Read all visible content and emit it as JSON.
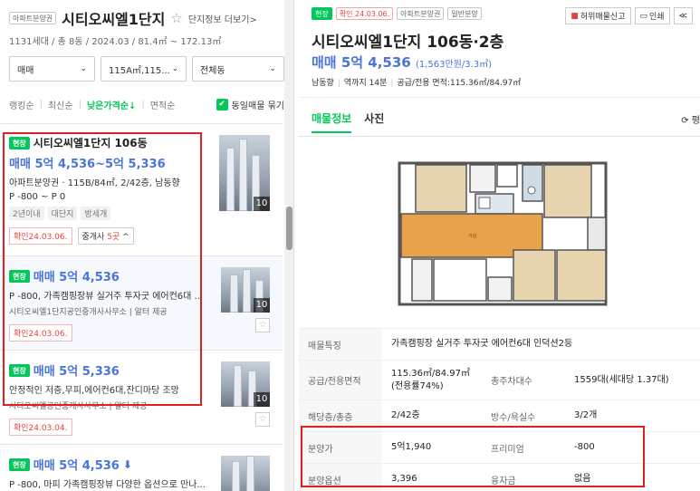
{
  "left": {
    "tag": "아파트분양권",
    "complex_name": "시티오씨엘1단지",
    "star": "☆",
    "more_link": "단지정보 더보기>",
    "meta": "1131세대 / 총 8동 / 2024.03 / 81.4㎡ ~ 172.13㎡",
    "filters": [
      {
        "label": "매매"
      },
      {
        "label": "115A㎡,115..."
      },
      {
        "label": "전체동"
      }
    ],
    "sort": {
      "ranking": "랭킹순",
      "newest": "최신순",
      "low_price": "낮은가격순↓",
      "area": "면적순",
      "same_group": "동일매물 묶기",
      "check": "✔"
    },
    "items": [
      {
        "badge": "현장",
        "title": "시티오씨엘1단지 106동",
        "price": "매매 5억 4,536~5억 5,336",
        "desc": "아파트분양권 · 115B/84㎡, 2/42층, 남동향",
        "sub": "P -800 ~ P 0",
        "chips": [
          "2년이내",
          "대단지",
          "방세개"
        ],
        "confirm": "확인24.03.06.",
        "brokers_prefix": "중개사 ",
        "brokers_count": "5곳",
        "brokers_suffix": " ^",
        "photo_count": "10"
      },
      {
        "badge": "현장",
        "price": "매매 5억 4,536",
        "desc": "P -800, 가족캠핑장뷰 실거주 투자굿 에어컨6대 ...",
        "sub": "시티오씨엘1단지공인중개사사무소 | 알터 제공",
        "confirm": "확인24.03.06.",
        "photo_count": "10",
        "fav": "☆"
      },
      {
        "badge": "현장",
        "price": "매매 5억 5,336",
        "desc": "안정적인 저층,무피,에어컨6대,잔디마당 조망",
        "sub": "시티오씨엘공인중개사사무소 | 알터 제공",
        "confirm": "확인24.03.04.",
        "photo_count": "10",
        "fav": "☆"
      },
      {
        "badge": "현장",
        "price": "매매 5억 4,536",
        "down": "⬇",
        "desc": "P -800, 마피 가족캠핑장뷰 다양한 옵션으로 만나..."
      }
    ]
  },
  "right": {
    "tags": [
      "현장",
      "확인 24.03.06.",
      "아파트분양권",
      "일반분양"
    ],
    "actions": {
      "report": "허위매물신고",
      "print": "인쇄",
      "close": "≪"
    },
    "title": "시티오씨엘1단지 106동·2층",
    "price": "매매 5억 4,536",
    "price_unit": "(1,563만원/3.3㎡)",
    "meta": {
      "direction": "남동향",
      "stairs": "역까지 14분",
      "area": "공급/전용 면적:115.36㎡/84.97㎡"
    },
    "tabs": {
      "info": "매물정보",
      "photo": "사진"
    },
    "refresh": "⟳ 평",
    "floorplan": {
      "living": "거실"
    },
    "table": [
      {
        "k1": "매물특징",
        "v1": "가족캠핑장 실거주 투자굿 에어컨6대 인덕션2등"
      },
      {
        "k1": "공급/전용면적",
        "v1": "115.36㎡/84.97㎡(전용률74%)",
        "k2": "총주차대수",
        "v2": "1559대(세대당 1.37대)"
      },
      {
        "k1": "해당층/총층",
        "v1": "2/42층",
        "k2": "방수/욕실수",
        "v2": "3/2개"
      },
      {
        "k1": "분양가",
        "v1": "5억1,940",
        "k2": "프리미엄",
        "v2": "-800"
      },
      {
        "k1": "분양옵션",
        "v1": "3,396",
        "k2": "융자금",
        "v2": "없음"
      }
    ]
  }
}
